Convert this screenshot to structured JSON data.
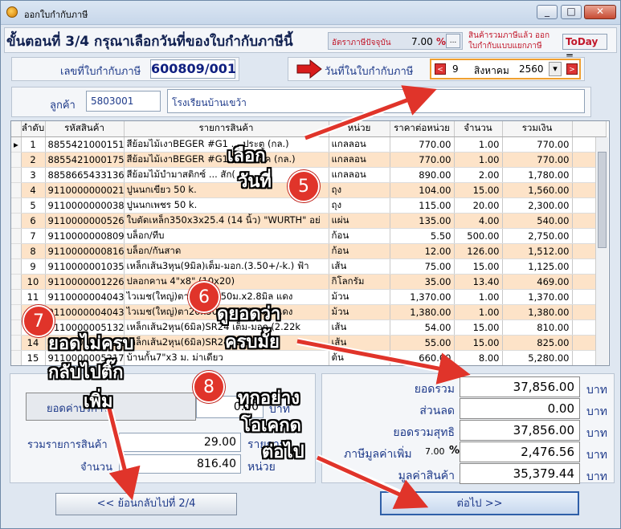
{
  "window": {
    "title": "ออกใบกำกับภาษี",
    "minimize": "_",
    "maximize": "□",
    "close": "✕"
  },
  "header": {
    "step_title": "ขั้นตอนที่ 3/4 กรุณาเลือกวันที่ของใบกำกับภาษีนี้",
    "tax_rate_label": "อัตราภาษีปัจจุบัน",
    "tax_rate_value": "7.00",
    "tax_rate_unit": "%",
    "tax_rate_btn": "...",
    "vat_note_line1": "สินค้ารวมภาษีแล้ว ออก",
    "vat_note_line2": "ใบกำกับแบบแยกภาษี",
    "today_btn": "ToDay",
    "today_eq": "="
  },
  "invoice": {
    "number_label": "เลขที่ใบกำกับภาษี",
    "number_value": "600809/001",
    "date_label": "วันที่ในใบกำกับภาษี",
    "date_day": "9",
    "date_month": "สิงหาคม",
    "date_year": "2560",
    "prev_btn": "<",
    "next_btn": ">",
    "dropdown": "▾"
  },
  "customer": {
    "label": "ลูกค้า",
    "code": "5803001",
    "name": "โรงเรียนบ้านเขว้า"
  },
  "table": {
    "columns": [
      "ลำดับ",
      "รหัสสินค้า",
      "รายการสินค้า",
      "หน่วย",
      "ราคาต่อหน่วย",
      "จำนวน",
      "รวมเงิน"
    ],
    "rows": [
      [
        "1",
        "8855421000151",
        "สีย้อมไม้เงาBEGER #G1 ... ประตู (กล.)",
        "แกลลอน",
        "770.00",
        "1.00",
        "770.00"
      ],
      [
        "2",
        "8855421000175",
        "สีย้อมไม้เงาBEGER #G1900 สีโอ๊ค (กล.)",
        "แกลลอน",
        "770.00",
        "1.00",
        "770.00"
      ],
      [
        "3",
        "8858665433136",
        "สีย้อมไม้บำมาสติกซ์ ... สัก(",
        "แกลลอน",
        "890.00",
        "2.00",
        "1,780.00"
      ],
      [
        "4",
        "9110000000021",
        "ปูนนกเขียว 50 k.",
        "ถุง",
        "104.00",
        "15.00",
        "1,560.00"
      ],
      [
        "5",
        "9110000000038",
        "ปูนนกเพชร 50 k.",
        "ถุง",
        "115.00",
        "20.00",
        "2,300.00"
      ],
      [
        "6",
        "9110000000526",
        "ใบตัดเหล็ก350x3x25.4 (14 นิ้ว) \"WURTH\" อย่",
        "แผ่น",
        "135.00",
        "4.00",
        "540.00"
      ],
      [
        "7",
        "9110000000809",
        "บล็อก/ทีบ",
        "ก้อน",
        "5.50",
        "500.00",
        "2,750.00"
      ],
      [
        "8",
        "9110000000816",
        "บล็อก/กันสาด",
        "ก้อน",
        "12.00",
        "126.00",
        "1,512.00"
      ],
      [
        "9",
        "9110000001035",
        "เหล็กเส้น3หุน(9มิล)เต็ม-มอก.(3.50+/-k.) ฟ้า",
        "เส้น",
        "75.00",
        "15.00",
        "1,125.00"
      ],
      [
        "10",
        "9110000001226",
        "ปลอกคาน 4\"x8\" (10x20)",
        "กิโลกรัม",
        "35.00",
        "13.40",
        "469.00"
      ],
      [
        "11",
        "9110000004043",
        "ไวเมช(ใหญ่)ตา20x50.50ม.x2.8มิล แดง",
        "ม้วน",
        "1,370.00",
        "1.00",
        "1,370.00"
      ],
      [
        "12",
        "9110000004043",
        "ไวเมช(ใหญ่)ตา20x50.50ม.x2.8มิล แดง",
        "ม้วน",
        "1,380.00",
        "1.00",
        "1,380.00"
      ],
      [
        "13",
        "9110000005132",
        "เหล็กเส้น2หุน(6มิล)SR24 เต็ม-มอก.(2.22k",
        "เส้น",
        "54.00",
        "15.00",
        "810.00"
      ],
      [
        "14",
        "9110000005132",
        "เหล็กเส้น2หุน(6มิล)SR24 (2.22k",
        "เส้น",
        "55.00",
        "15.00",
        "825.00"
      ],
      [
        "15",
        "9110000005217",
        "บ้านกั้น7\"x3 ม. ม่าเดียว",
        "ต้น",
        "660.00",
        "8.00",
        "5,280.00"
      ]
    ]
  },
  "left_summary": {
    "discount_label": "ยอดค่าบริการ",
    "discount_value": "0.00",
    "discount_unit": "บาท",
    "items_label": "รวมรายการสินค้า",
    "items_value": "29.00",
    "items_unit": "รายการ",
    "qty_label": "จำนวน",
    "qty_value": "816.40",
    "qty_unit": "หน่วย"
  },
  "totals": {
    "total_label": "ยอดรวม",
    "total_value": "37,856.00",
    "discount_label": "ส่วนลด",
    "discount_value": "0.00",
    "net_label": "ยอดรวมสุทธิ",
    "net_value": "37,856.00",
    "vat_label": "ภาษีมูลค่าเพิ่ม",
    "vat_rate": "7.00",
    "vat_pct": "%",
    "vat_value": "2,476.56",
    "goods_label": "มูลค่าสินค้า",
    "goods_value": "35,379.44",
    "unit": "บาท"
  },
  "nav": {
    "back": "<< ย้อนกลับไปที่ 2/4",
    "next": "ต่อไป >>"
  },
  "annotations": {
    "n5": "5",
    "t5a": "เลือก",
    "t5b": "วันที่",
    "n6": "6",
    "t6a": "ดูยอดว่า",
    "t6b": "ครบมั้ย",
    "n7": "7",
    "t7a": "ยอดไม่ครบ",
    "t7b": "กลับไปติ๊ก",
    "t7c": "เพิ่ม",
    "n8": "8",
    "t8a": "ทุกอย่าง",
    "t8b": "โอเคกด",
    "t8c": "ต่อไป"
  },
  "colors": {
    "row_alt": "#fde3c8",
    "accent_red": "#e0342a",
    "label_blue": "#1e3a8a"
  }
}
